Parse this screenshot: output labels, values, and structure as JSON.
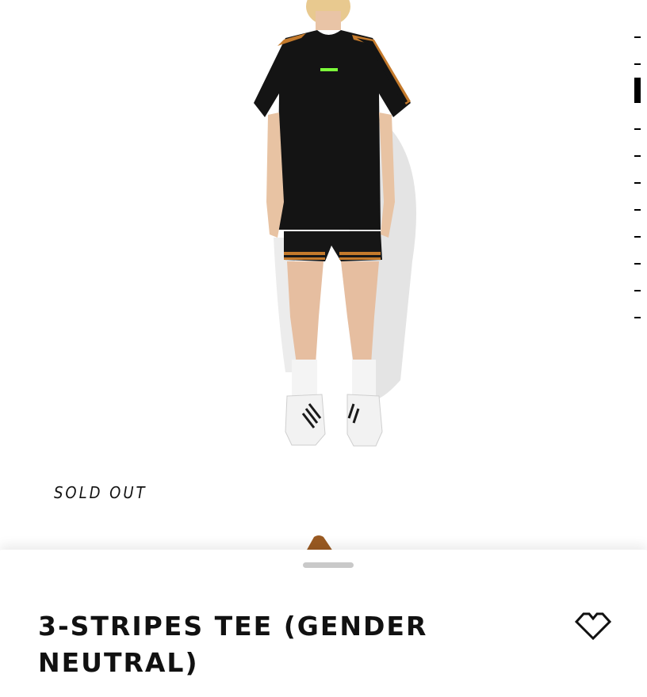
{
  "gallery": {
    "status_label": "SOLD OUT",
    "image_icon": "product-photo-model-icon",
    "pager": {
      "total": 11,
      "active_index": 2
    }
  },
  "product": {
    "title": "3-STRIPES TEE (GENDER NEUTRAL)",
    "wishlist_icon": "heart-outline-icon"
  },
  "colors": {
    "accent_stripe": "#c47a2c",
    "text": "#111111",
    "grabber": "#c9c9c9"
  }
}
